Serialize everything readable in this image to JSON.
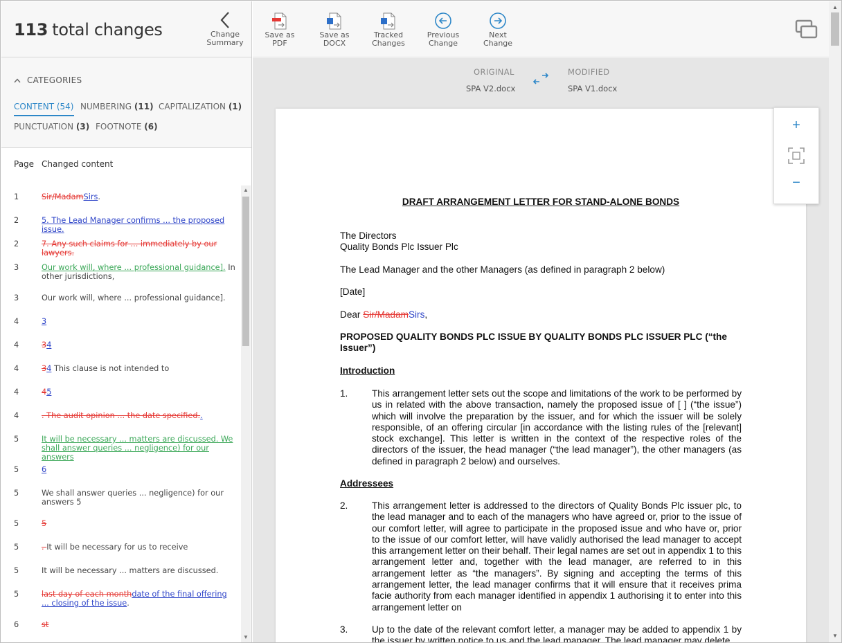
{
  "summary": {
    "count": "113",
    "label": "total changes"
  },
  "change_summary_btn": {
    "line1": "Change",
    "line2": "Summary"
  },
  "toolbar": {
    "save_pdf": {
      "line1": "Save as PDF",
      "line2": ""
    },
    "save_docx": {
      "line1": "Save as",
      "line2": "DOCX"
    },
    "tracked": {
      "line1": "Tracked",
      "line2": "Changes"
    },
    "prev": {
      "line1": "Previous",
      "line2": "Change"
    },
    "next": {
      "line1": "Next Change",
      "line2": ""
    }
  },
  "categories": {
    "title": "CATEGORIES",
    "items": [
      {
        "label": "CONTENT",
        "count": "(54)"
      },
      {
        "label": "NUMBERING",
        "count": "(11)"
      },
      {
        "label": "CAPITALIZATION",
        "count": "(1)"
      },
      {
        "label": "PUNCTUATION",
        "count": "(3)"
      },
      {
        "label": "FOOTNOTE",
        "count": "(6)"
      }
    ]
  },
  "list_header": {
    "page": "Page",
    "content": "Changed content"
  },
  "rows": [
    {
      "page": "1",
      "parts": [
        {
          "t": "del",
          "s": "Sir/Madam"
        },
        {
          "t": "ins",
          "s": "Sirs"
        },
        {
          "t": "plain",
          "s": "."
        }
      ]
    },
    {
      "page": "2",
      "parts": [
        {
          "t": "ins",
          "s": "5. The Lead Manager confirms ... the proposed issue."
        }
      ]
    },
    {
      "page": "2",
      "parts": [
        {
          "t": "del",
          "s": "7. Any such claims for ... immediately by our lawyers."
        }
      ]
    },
    {
      "page": "3",
      "parts": [
        {
          "t": "mov",
          "s": "Our work will, where ... professional guidance]."
        },
        {
          "t": "plain",
          "s": " In other jurisdictions,"
        }
      ]
    },
    {
      "page": "3",
      "parts": [
        {
          "t": "plain",
          "s": "Our work will, where ... professional guidance]."
        }
      ]
    },
    {
      "page": "4",
      "parts": [
        {
          "t": "ins",
          "s": "3"
        }
      ]
    },
    {
      "page": "4",
      "parts": [
        {
          "t": "del",
          "s": "3"
        },
        {
          "t": "ins",
          "s": "4"
        }
      ]
    },
    {
      "page": "4",
      "parts": [
        {
          "t": "del",
          "s": "3"
        },
        {
          "t": "ins",
          "s": "4"
        },
        {
          "t": "plain",
          "s": " This clause is not intended to"
        }
      ]
    },
    {
      "page": "4",
      "parts": [
        {
          "t": "del",
          "s": "4"
        },
        {
          "t": "ins",
          "s": "5"
        }
      ]
    },
    {
      "page": "4",
      "parts": [
        {
          "t": "del",
          "s": ". The audit opinion ... the date specified."
        },
        {
          "t": "ins",
          "s": "."
        }
      ]
    },
    {
      "page": "5",
      "parts": [
        {
          "t": "mov",
          "s": "It will be necessary ... matters are discussed. We shall answer queries ... negligence) for our answers"
        }
      ]
    },
    {
      "page": "5",
      "parts": [
        {
          "t": "ins",
          "s": "6"
        }
      ]
    },
    {
      "page": "5",
      "parts": [
        {
          "t": "plain",
          "s": "We shall answer queries ... negligence) for our answers 5"
        }
      ]
    },
    {
      "page": "5",
      "parts": [
        {
          "t": "del",
          "s": "5"
        }
      ]
    },
    {
      "page": "5",
      "parts": [
        {
          "t": "del",
          "s": ". "
        },
        {
          "t": "plain",
          "s": "It will be necessary for us to receive"
        }
      ]
    },
    {
      "page": "5",
      "parts": [
        {
          "t": "plain",
          "s": "It will be necessary ... matters are discussed."
        }
      ]
    },
    {
      "page": "5",
      "parts": [
        {
          "t": "del",
          "s": "last day of each month"
        },
        {
          "t": "ins",
          "s": "date of the final offering ... closing of the issue"
        },
        {
          "t": "plain",
          "s": "."
        }
      ]
    },
    {
      "page": "6",
      "parts": [
        {
          "t": "del",
          "s": "st"
        }
      ]
    }
  ],
  "compare": {
    "original_label": "ORIGINAL",
    "original_file": "SPA V2.docx",
    "modified_label": "MODIFIED",
    "modified_file": "SPA V1.docx"
  },
  "document": {
    "title": "DRAFT ARRANGEMENT LETTER FOR STAND-ALONE BONDS",
    "addr1": "The Directors",
    "addr2": "Quality Bonds Plc Issuer Plc",
    "lead": "The Lead Manager and the other Managers (as defined in paragraph 2 below)",
    "date": "[Date]",
    "dear": "Dear ",
    "dear_del": "Sir/Madam",
    "dear_ins": "Sirs",
    "dear_end": ",",
    "subject": "PROPOSED QUALITY BONDS PLC ISSUE BY QUALITY BONDS PLC ISSUER PLC (“the Issuer”)",
    "h_intro": "Introduction",
    "p1_num": "1.",
    "p1": "This arrangement letter sets out the scope and limitations of the work to be performed by us in related with the above transaction, namely the proposed issue of [ ] (“the issue”) which will involve the preparation by the issuer, and for which the issuer will be solely responsible, of an offering circular [in accordance with the listing rules of the [relevant] stock exchange].  This letter is written in the context of the respective roles of the directors of the issuer, the head manager (“the lead manager”), the other managers (as defined in paragraph 2 below) and ourselves.",
    "h_addr": "Addressees",
    "p2_num": "2.",
    "p2": "This arrangement letter is addressed to the directors of Quality Bonds Plc issuer plc, to the lead manager and to each of the managers who have agreed or, prior to the issue of our comfort letter, will agree to participate in the proposed issue and who have or, prior to the issue of our comfort letter, will have validly authorised the lead manager to accept this arrangement letter on their behalf. Their legal names are set out in appendix 1 to this arrangement letter and, together with the lead manager, are referred to in this arrangement letter as “the managers”.  By signing and accepting the terms of this arrangement letter, the lead manager confirms that it will ensure that it receives prima facie authority from each manager identified in appendix 1 authorising it to enter into this arrangement letter on",
    "p3_num": "3.",
    "p3": "Up to the date of the relevant comfort letter, a manager may be added to appendix 1 by the issuer by written notice to us and the lead manager.  The lead manager may delete"
  },
  "zoom": {
    "in": "+",
    "out": "−"
  },
  "colors": {
    "accent": "#2d87c8",
    "deleted": "#e53935",
    "inserted": "#2e44c8",
    "moved": "#3aa757"
  }
}
